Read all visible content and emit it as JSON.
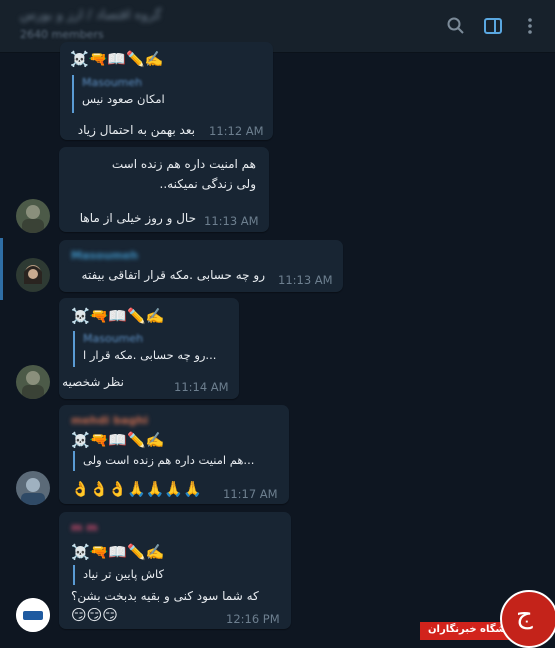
{
  "header": {
    "title": "گروه اقتصاد / ارز و بورس",
    "members": "2640 members"
  },
  "messages": [
    {
      "emoji": "☠️🔫📖✏️✍️",
      "reply_name": "Masoumeh",
      "reply_text": "امکان صعود نیس",
      "text": "بعد بهمن به احتمال زیاد",
      "time": "11:12 AM"
    },
    {
      "lines": [
        "هم امنیت داره هم زنده است",
        "ولی زندگی نمیکنه..",
        "حال و روز خیلی از ماها"
      ],
      "time": "11:13 AM"
    },
    {
      "sender": "Masoumeh",
      "text": "رو چه حسابی .مکه قرار اتفاقی بیفته",
      "time": "11:13 AM"
    },
    {
      "emoji": "☠️🔫📖✏️✍️",
      "reply_name": "Masoumeh",
      "reply_text": "...رو چه حسابی .مکه قرار ا",
      "text": "نظر شخصیه",
      "time": "11:14 AM"
    },
    {
      "sender": "mehdi baghi",
      "emoji": "☠️🔫📖✏️✍️",
      "reply_text": "...هم امنیت داره هم زنده است ولی",
      "reactions": "👌👌👌🙏🙏🙏🙏",
      "time": "11:17 AM"
    },
    {
      "sender": "m m",
      "emoji": "☠️🔫📖✏️✍️",
      "reply_text": "کاش پایین تر نیاد",
      "text": "که شما سود کنی و بقیه بدبخت بشن؟",
      "reactions": "😏😏😏",
      "time": "12:16 PM"
    }
  ],
  "watermark": {
    "text": "باشگاه خبرنگاران",
    "logo_letter": "ج"
  },
  "colors": {
    "background": "#0e1621",
    "bubble": "#182533",
    "header": "#17212b",
    "accent": "#5a9bd4",
    "brand_red": "#c4231a"
  }
}
